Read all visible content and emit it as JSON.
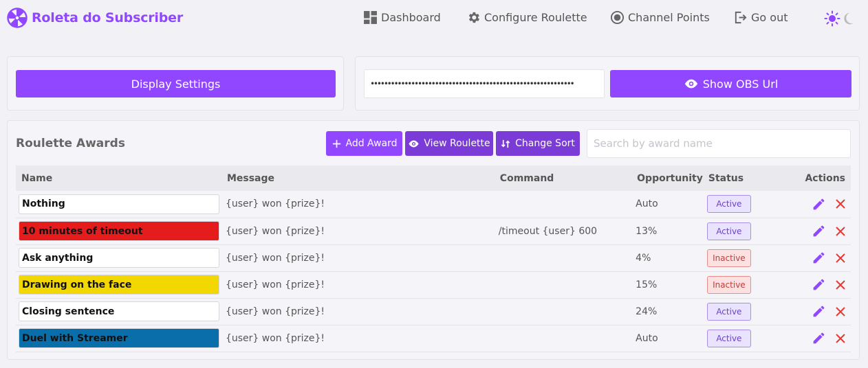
{
  "brand": {
    "name": "Roleta do Subscriber",
    "icon": "roulette-wheel-icon"
  },
  "nav": [
    {
      "label": "Dashboard",
      "icon": "dashboard-icon"
    },
    {
      "label": "Configure Roulette",
      "icon": "gear-icon"
    },
    {
      "label": "Channel Points",
      "icon": "record-icon"
    },
    {
      "label": "Go out",
      "icon": "logout-icon"
    }
  ],
  "theme": {
    "light_icon": "sun-icon",
    "dark_icon": "moon-icon"
  },
  "display": {
    "settings_label": "Display Settings"
  },
  "obs": {
    "url_value": "••••••••••••••••••••••••••••••••••••••••••••••••••••••••••••",
    "show_label": "Show OBS Url",
    "show_icon": "eye-icon"
  },
  "awards": {
    "title": "Roulette Awards",
    "add_label": "Add Award",
    "view_label": "View Roulette",
    "sort_label": "Change Sort",
    "search_placeholder": "Search by award name",
    "columns": [
      "Name",
      "Message",
      "Command",
      "Opportunity",
      "Status",
      "Actions"
    ],
    "rows": [
      {
        "name": "Nothing",
        "color": "#ffffff",
        "message": "{user} won {prize}!",
        "command": "",
        "opportunity": "Auto",
        "status": "Active"
      },
      {
        "name": "10 minutes of timeout",
        "color": "#e51c1c",
        "message": "{user} won {prize}!",
        "command": "/timeout {user} 600",
        "opportunity": "13%",
        "status": "Active"
      },
      {
        "name": "Ask anything",
        "color": "#ffffff",
        "message": "{user} won {prize}!",
        "command": "",
        "opportunity": "4%",
        "status": "Inactive"
      },
      {
        "name": "Drawing on the face",
        "color": "#f2d800",
        "message": "{user} won {prize}!",
        "command": "",
        "opportunity": "15%",
        "status": "Inactive"
      },
      {
        "name": "Closing sentence",
        "color": "#ffffff",
        "message": "{user} won {prize}!",
        "command": "",
        "opportunity": "24%",
        "status": "Active"
      },
      {
        "name": "Duel with Streamer",
        "color": "#0a6eaa",
        "message": "{user} won {prize}!",
        "command": "",
        "opportunity": "Auto",
        "status": "Active"
      }
    ]
  },
  "colors": {
    "brand": "#9147ff",
    "view_button": "#7a3bd6",
    "active_bg": "#e9e3ff",
    "active_border": "#a98be8",
    "active_text": "#6a44c2",
    "inactive_bg": "#fde0e0",
    "inactive_border": "#e88b8b",
    "inactive_text": "#c43a3a",
    "edit_icon": "#9147ff",
    "delete_icon": "#e53935"
  }
}
